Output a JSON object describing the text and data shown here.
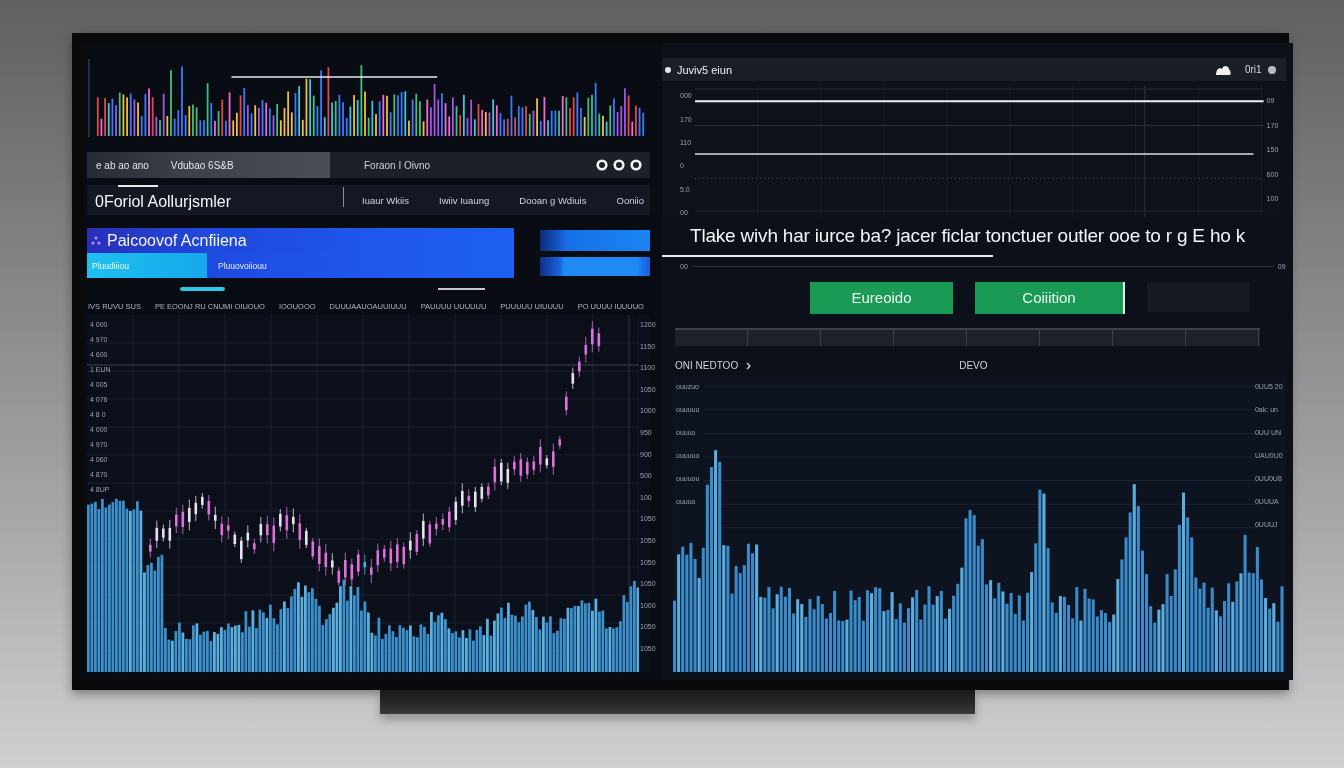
{
  "left_panel": {
    "toolbar": {
      "texts": [
        "e ab ao ano",
        "Vdubao 6S&B",
        "Foraon I Oivno"
      ]
    },
    "title": "0Foriol Aollurjsmler",
    "nav": [
      "Iuaur Wkiis",
      "Iwiiv Iuaung",
      "Dooan g Wdiuis",
      "Ooniio"
    ],
    "banner": {
      "title": "Paicoovof Acnfiiena",
      "tabs": [
        {
          "label": "Pluudiiiou",
          "selected": true
        },
        {
          "label": "Pluuovoiiouu",
          "selected": false
        }
      ]
    },
    "chart": {
      "column_labels": [
        "IVS RUVU SUS",
        "PE EOONJ RU CNUMI OIUOUO",
        "IOOUOOO",
        "DUUUAAUOAUUIUUU",
        "PAUUUU UUUUUU",
        "PUUUUU UIUUUU",
        "PO UUUU IUUUUO"
      ],
      "left_labels": [
        "4 000",
        "4 970",
        "4 600",
        "1 EUN",
        "4 005",
        "4 076",
        "4 8 0",
        "4 000",
        "4 970",
        "4 060",
        "4 870",
        "4 8UP"
      ],
      "right_labels": [
        "1200",
        "1150",
        "1100",
        "1050",
        "1000",
        "950",
        "900",
        "500",
        "100",
        "1050",
        "1050",
        "1050",
        "1050",
        "1000",
        "1050",
        "1050"
      ]
    }
  },
  "right_panel": {
    "header": {
      "title": "Juviv5 eiun",
      "status": "0ri1"
    },
    "line_chart": {
      "left_labels": [
        "000",
        "170",
        "110",
        "0",
        "5.0",
        "00"
      ],
      "right_labels": [
        "09",
        "170",
        "150",
        "600",
        "100"
      ],
      "baseline_labels": [
        "00",
        "09"
      ]
    },
    "message": "Tlake wivh har iurce ba? jacer ficlar tonctuer outler ooe to r g E ho k",
    "buttons": [
      "Eureoido",
      "Coiiition"
    ],
    "volume_chart": {
      "title": "ONI NEDTOO",
      "label": "DEVO",
      "left_labels": [
        "ouuzuo",
        "ouuuuu",
        "ouuuo",
        "ouuuuo",
        "ouuuou",
        "ouuuo"
      ],
      "right_labels": [
        "0UU5 20",
        "0ak: un",
        "0UU UN",
        "UAU0U0",
        "0UU0U8",
        "0UUUA",
        "0UUUJ"
      ]
    }
  }
}
